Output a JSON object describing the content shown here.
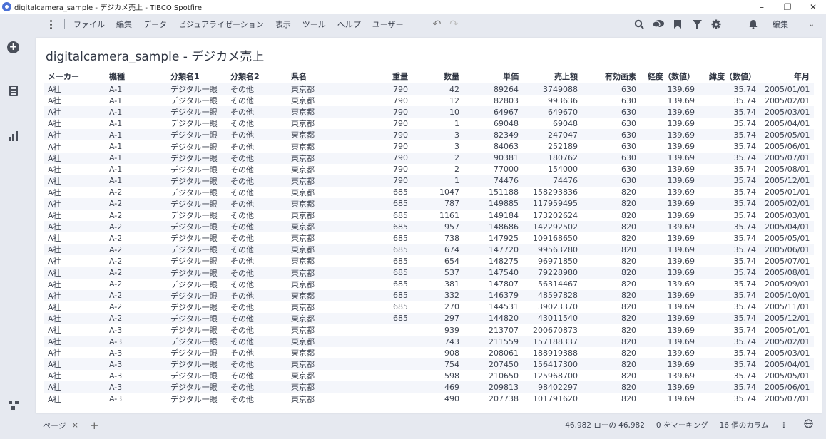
{
  "window": {
    "title": "digitalcamera_sample - デジカメ売上 - TIBCO Spotfire",
    "minimize": "–",
    "restore": "❐",
    "close": "✕"
  },
  "menu": {
    "items": [
      "ファイル",
      "編集",
      "データ",
      "ビジュアライゼーション",
      "表示",
      "ツール",
      "ヘルプ",
      "ユーザー"
    ],
    "undo": "↶",
    "redo": "↷",
    "toolbar_icons": [
      "search-icon",
      "comment-icon",
      "bookmark-icon",
      "filter-icon",
      "settings-icon",
      "bell-icon"
    ],
    "mode": "編集",
    "mode_chevron": "⌄"
  },
  "panel": {
    "title": "digitalcamera_sample - デジカメ売上"
  },
  "table": {
    "columns": [
      "メーカー",
      "機種",
      "分類名1",
      "分類名2",
      "県名",
      "重量",
      "数量",
      "単価",
      "売上額",
      "有効画素",
      "経度（数値）",
      "緯度（数値）",
      "年月"
    ],
    "rows": [
      [
        "A社",
        "A-1",
        "デジタル一眼",
        "その他",
        "東京都",
        "790",
        "42",
        "89264",
        "3749088",
        "630",
        "139.69",
        "35.74",
        "2005/01/01"
      ],
      [
        "A社",
        "A-1",
        "デジタル一眼",
        "その他",
        "東京都",
        "790",
        "12",
        "82803",
        "993636",
        "630",
        "139.69",
        "35.74",
        "2005/02/01"
      ],
      [
        "A社",
        "A-1",
        "デジタル一眼",
        "その他",
        "東京都",
        "790",
        "10",
        "64967",
        "649670",
        "630",
        "139.69",
        "35.74",
        "2005/03/01"
      ],
      [
        "A社",
        "A-1",
        "デジタル一眼",
        "その他",
        "東京都",
        "790",
        "1",
        "69048",
        "69048",
        "630",
        "139.69",
        "35.74",
        "2005/04/01"
      ],
      [
        "A社",
        "A-1",
        "デジタル一眼",
        "その他",
        "東京都",
        "790",
        "3",
        "82349",
        "247047",
        "630",
        "139.69",
        "35.74",
        "2005/05/01"
      ],
      [
        "A社",
        "A-1",
        "デジタル一眼",
        "その他",
        "東京都",
        "790",
        "3",
        "84063",
        "252189",
        "630",
        "139.69",
        "35.74",
        "2005/06/01"
      ],
      [
        "A社",
        "A-1",
        "デジタル一眼",
        "その他",
        "東京都",
        "790",
        "2",
        "90381",
        "180762",
        "630",
        "139.69",
        "35.74",
        "2005/07/01"
      ],
      [
        "A社",
        "A-1",
        "デジタル一眼",
        "その他",
        "東京都",
        "790",
        "2",
        "77000",
        "154000",
        "630",
        "139.69",
        "35.74",
        "2005/08/01"
      ],
      [
        "A社",
        "A-1",
        "デジタル一眼",
        "その他",
        "東京都",
        "790",
        "1",
        "74476",
        "74476",
        "630",
        "139.69",
        "35.74",
        "2005/12/01"
      ],
      [
        "A社",
        "A-2",
        "デジタル一眼",
        "その他",
        "東京都",
        "685",
        "1047",
        "151188",
        "158293836",
        "820",
        "139.69",
        "35.74",
        "2005/01/01"
      ],
      [
        "A社",
        "A-2",
        "デジタル一眼",
        "その他",
        "東京都",
        "685",
        "787",
        "149885",
        "117959495",
        "820",
        "139.69",
        "35.74",
        "2005/02/01"
      ],
      [
        "A社",
        "A-2",
        "デジタル一眼",
        "その他",
        "東京都",
        "685",
        "1161",
        "149184",
        "173202624",
        "820",
        "139.69",
        "35.74",
        "2005/03/01"
      ],
      [
        "A社",
        "A-2",
        "デジタル一眼",
        "その他",
        "東京都",
        "685",
        "957",
        "148686",
        "142292502",
        "820",
        "139.69",
        "35.74",
        "2005/04/01"
      ],
      [
        "A社",
        "A-2",
        "デジタル一眼",
        "その他",
        "東京都",
        "685",
        "738",
        "147925",
        "109168650",
        "820",
        "139.69",
        "35.74",
        "2005/05/01"
      ],
      [
        "A社",
        "A-2",
        "デジタル一眼",
        "その他",
        "東京都",
        "685",
        "674",
        "147720",
        "99563280",
        "820",
        "139.69",
        "35.74",
        "2005/06/01"
      ],
      [
        "A社",
        "A-2",
        "デジタル一眼",
        "その他",
        "東京都",
        "685",
        "654",
        "148275",
        "96971850",
        "820",
        "139.69",
        "35.74",
        "2005/07/01"
      ],
      [
        "A社",
        "A-2",
        "デジタル一眼",
        "その他",
        "東京都",
        "685",
        "537",
        "147540",
        "79228980",
        "820",
        "139.69",
        "35.74",
        "2005/08/01"
      ],
      [
        "A社",
        "A-2",
        "デジタル一眼",
        "その他",
        "東京都",
        "685",
        "381",
        "147807",
        "56314467",
        "820",
        "139.69",
        "35.74",
        "2005/09/01"
      ],
      [
        "A社",
        "A-2",
        "デジタル一眼",
        "その他",
        "東京都",
        "685",
        "332",
        "146379",
        "48597828",
        "820",
        "139.69",
        "35.74",
        "2005/10/01"
      ],
      [
        "A社",
        "A-2",
        "デジタル一眼",
        "その他",
        "東京都",
        "685",
        "270",
        "144531",
        "39023370",
        "820",
        "139.69",
        "35.74",
        "2005/11/01"
      ],
      [
        "A社",
        "A-2",
        "デジタル一眼",
        "その他",
        "東京都",
        "685",
        "297",
        "144820",
        "43011540",
        "820",
        "139.69",
        "35.74",
        "2005/12/01"
      ],
      [
        "A社",
        "A-3",
        "デジタル一眼",
        "その他",
        "東京都",
        "",
        "939",
        "213707",
        "200670873",
        "820",
        "139.69",
        "35.74",
        "2005/01/01"
      ],
      [
        "A社",
        "A-3",
        "デジタル一眼",
        "その他",
        "東京都",
        "",
        "743",
        "211559",
        "157188337",
        "820",
        "139.69",
        "35.74",
        "2005/02/01"
      ],
      [
        "A社",
        "A-3",
        "デジタル一眼",
        "その他",
        "東京都",
        "",
        "908",
        "208061",
        "188919388",
        "820",
        "139.69",
        "35.74",
        "2005/03/01"
      ],
      [
        "A社",
        "A-3",
        "デジタル一眼",
        "その他",
        "東京都",
        "",
        "754",
        "207450",
        "156417300",
        "820",
        "139.69",
        "35.74",
        "2005/04/01"
      ],
      [
        "A社",
        "A-3",
        "デジタル一眼",
        "その他",
        "東京都",
        "",
        "598",
        "210650",
        "125968700",
        "820",
        "139.69",
        "35.74",
        "2005/05/01"
      ],
      [
        "A社",
        "A-3",
        "デジタル一眼",
        "その他",
        "東京都",
        "",
        "469",
        "209813",
        "98402297",
        "820",
        "139.69",
        "35.74",
        "2005/06/01"
      ],
      [
        "A社",
        "A-3",
        "デジタル一眼",
        "その他",
        "東京都",
        "",
        "490",
        "207738",
        "101791620",
        "820",
        "139.69",
        "35.74",
        "2005/07/01"
      ]
    ]
  },
  "bottom": {
    "page_tab": "ページ",
    "page_close": "×",
    "add_page": "+",
    "row_count": "46,982 ローの 46,982",
    "marking": "0 をマーキング",
    "columns": "16 個のカラム",
    "more": "⋮",
    "globe": "🌐"
  }
}
